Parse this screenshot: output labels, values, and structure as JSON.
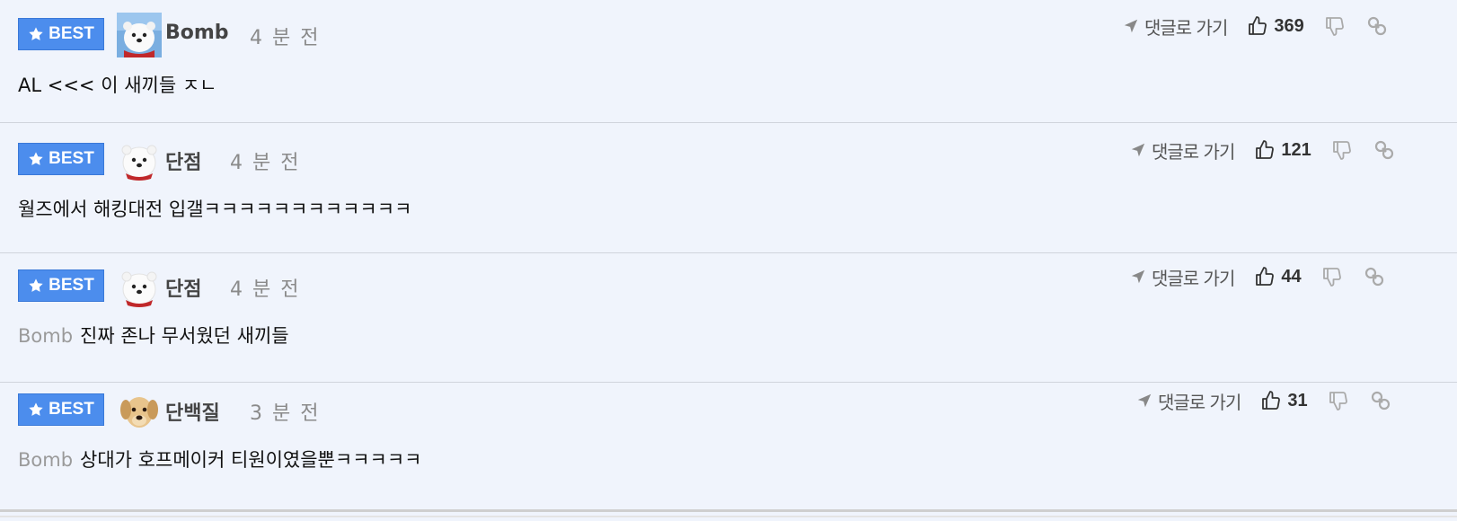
{
  "comments": [
    {
      "badge": "BEST",
      "nickname": "Bomb",
      "time": "4 분 전",
      "mention": "",
      "text": "AL <<< 이 새끼들 ㅈㄴ",
      "reply_label": "댓글로 가기",
      "likes": "369",
      "avatar": "polar-bear-scarf"
    },
    {
      "badge": "BEST",
      "nickname": "단점",
      "time": "4 분 전",
      "mention": "",
      "text": "월즈에서 해킹대전 입갤ㅋㅋㅋㅋㅋㅋㅋㅋㅋㅋㅋㅋ",
      "reply_label": "댓글로 가기",
      "likes": "121",
      "avatar": "polar-bear-cub"
    },
    {
      "badge": "BEST",
      "nickname": "단점",
      "time": "4 분 전",
      "mention": "Bomb",
      "text": "진짜 존나 무서웠던 새끼들",
      "reply_label": "댓글로 가기",
      "likes": "44",
      "avatar": "polar-bear-cub"
    },
    {
      "badge": "BEST",
      "nickname": "단백질",
      "time": "3 분 전",
      "mention": "Bomb",
      "text": "상대가 호프메이커 티원이였을뿐ㅋㅋㅋㅋㅋ",
      "reply_label": "댓글로 가기",
      "likes": "31",
      "avatar": "puppy"
    }
  ],
  "colors": {
    "background": "#f0f4fc",
    "best_badge": "#4c8ded",
    "mention": "#9a9a9a",
    "time": "#8a8a8a"
  }
}
